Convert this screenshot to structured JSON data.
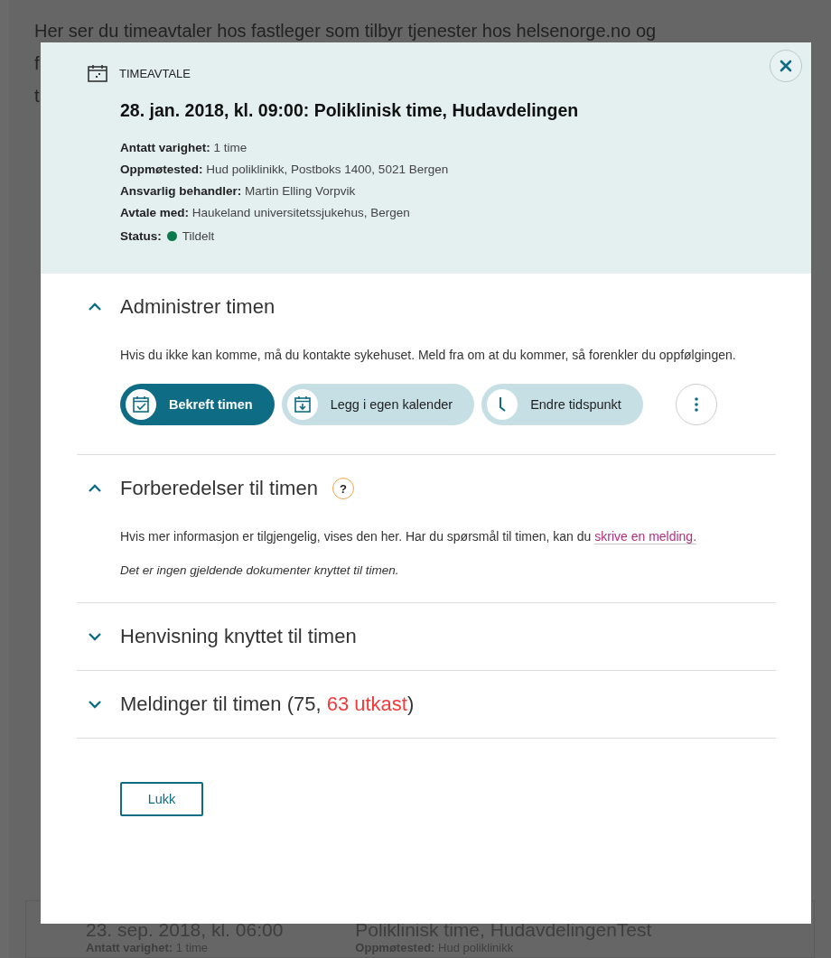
{
  "background": {
    "intro_lines": [
      "Her ser du timeavtaler hos fastleger som tilbyr tjenester hos helsenorge.no og",
      "f",
      "t"
    ],
    "card": {
      "date": "23. sep. 2018, kl. 06:00",
      "duration_label": "Antatt varighet:",
      "duration": "1 time",
      "title": "Poliklinisk time, HudavdelingenTest",
      "place_label": "Oppmøtested:",
      "place": "Hud poliklinikk"
    }
  },
  "modal": {
    "category": "TIMEAVTALE",
    "title": "28. jan. 2018, kl. 09:00: Poliklinisk time, Hudavdelingen",
    "details": [
      {
        "label": "Antatt varighet:",
        "value": "1 time"
      },
      {
        "label": "Oppmøtested:",
        "value": "Hud poliklinikk, Postboks 1400, 5021 Bergen"
      },
      {
        "label": "Ansvarlig behandler:",
        "value": "Martin Elling Vorpvik"
      },
      {
        "label": "Avtale med:",
        "value": "Haukeland universitetssjukehus, Bergen"
      }
    ],
    "status": {
      "label": "Status:",
      "value": "Tildelt",
      "color": "#0b7a4b"
    },
    "sections": [
      {
        "kind": "actions",
        "title": "Administrer timen",
        "expanded": true,
        "text": "Hvis du ikke kan komme, må du kontakte sykehuset. Meld fra om at du kommer, så forenkler du oppfølgingen.",
        "buttons": [
          {
            "label": "Bekreft timen",
            "kind": "primary"
          },
          {
            "label": "Legg i egen kalender",
            "kind": "secondary"
          },
          {
            "label": "Endre tidspunkt",
            "kind": "secondary"
          },
          {
            "kind": "more"
          }
        ]
      },
      {
        "kind": "info",
        "title": "Forberedelser til timen",
        "expanded": true,
        "help": "?",
        "text": "Hvis mer informasjon er tilgjengelig, vises den her. Har du spørsmål til timen, kan du",
        "link": "skrive en melding.",
        "note": "Det er ingen gjeldende dokumenter knyttet til timen."
      },
      {
        "kind": "plain",
        "title": "Henvisning knyttet til timen",
        "expanded": false
      },
      {
        "kind": "messages",
        "title": "Meldinger til timen (75, ",
        "drafts": "63 utkast",
        "suffix": ")",
        "expanded": false
      }
    ],
    "close_button": "Lukk"
  }
}
